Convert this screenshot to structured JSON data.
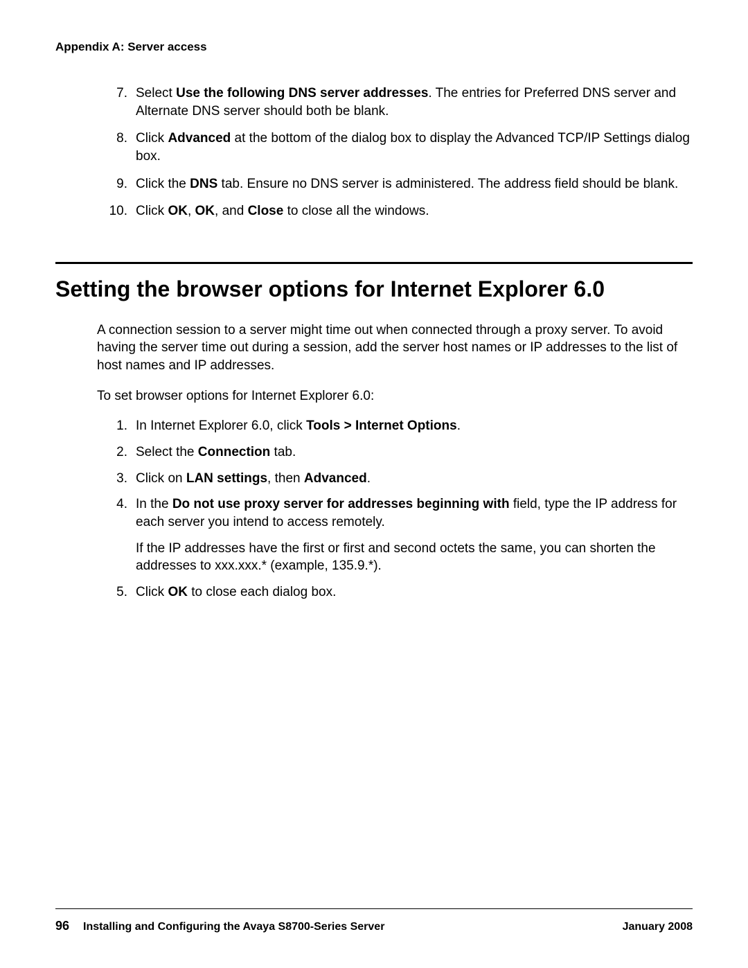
{
  "header": {
    "running": "Appendix A: Server access"
  },
  "top_list": {
    "items": [
      {
        "n": "7.",
        "html": "Select <b>Use the following DNS server addresses</b>. The entries for Preferred DNS server and Alternate DNS server should both be blank."
      },
      {
        "n": "8.",
        "html": "Click <b>Advanced</b> at the bottom of the dialog box to display the Advanced TCP/IP Settings dialog box."
      },
      {
        "n": "9.",
        "html": "Click the <b>DNS</b> tab. Ensure no DNS server is administered. The address field should be blank."
      },
      {
        "n": "10.",
        "html": "Click <b>OK</b>, <b>OK</b>, and <b>Close</b> to close all the windows."
      }
    ]
  },
  "section": {
    "title": "Setting the browser options for Internet Explorer 6.0",
    "intro1": "A connection session to a server might time out when connected through a proxy server. To avoid having the server time out during a session, add the server host names or IP addresses to the list of host names and IP addresses.",
    "intro2": "To set browser options for Internet Explorer 6.0:",
    "steps": [
      {
        "n": "1.",
        "html": "In Internet Explorer 6.0, click <b>Tools &gt; Internet Options</b>."
      },
      {
        "n": "2.",
        "html": "Select the <b>Connection</b> tab."
      },
      {
        "n": "3.",
        "html": "Click on <b>LAN settings</b>, then <b>Advanced</b>."
      },
      {
        "n": "4.",
        "html": "In the <b>Do not use proxy server for addresses beginning with</b> field, type the IP address for each server you intend to access remotely.",
        "sub": "If the IP addresses have the first or first and second octets the same, you can shorten the addresses to xxx.xxx.* (example, 135.9.*)."
      },
      {
        "n": "5.",
        "html": "Click <b>OK</b> to close each dialog box."
      }
    ]
  },
  "footer": {
    "page": "96",
    "title": "Installing and Configuring the Avaya S8700-Series Server",
    "date": "January 2008"
  }
}
